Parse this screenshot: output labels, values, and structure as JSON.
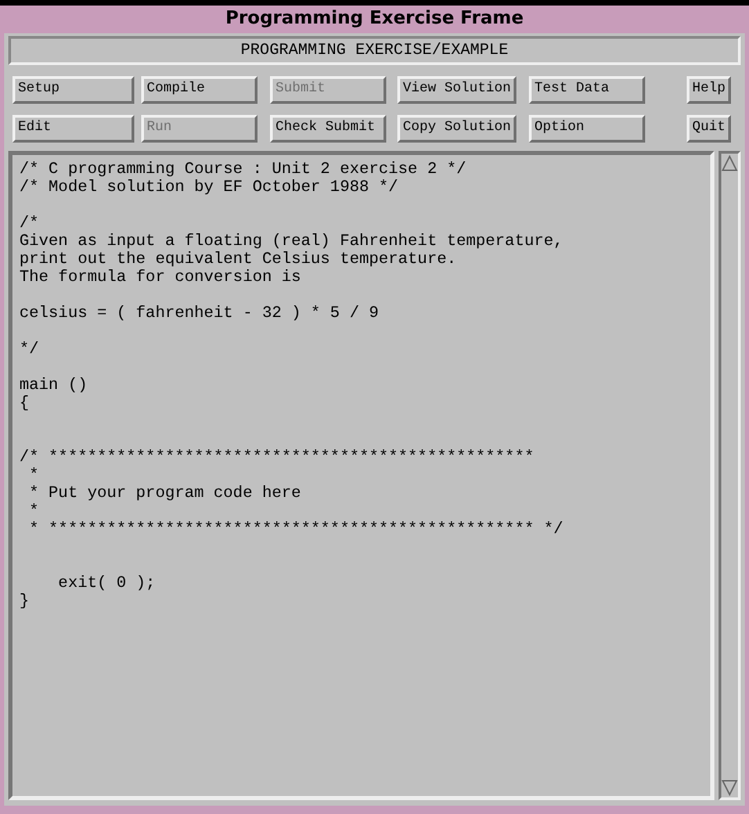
{
  "window": {
    "title": "Programming Exercise Frame"
  },
  "header": "PROGRAMMING EXERCISE/EXAMPLE",
  "button_rows": [
    [
      {
        "label": "Setup",
        "disabled": false
      },
      {
        "label": "Compile",
        "disabled": false
      },
      {
        "label": "Submit",
        "disabled": true
      },
      {
        "label": "View Solution",
        "disabled": false
      },
      {
        "label": "Test Data",
        "disabled": false
      },
      {
        "label": "Help",
        "disabled": false
      }
    ],
    [
      {
        "label": "Edit",
        "disabled": false
      },
      {
        "label": "Run",
        "disabled": true
      },
      {
        "label": "Check Submit",
        "disabled": false
      },
      {
        "label": "Copy Solution",
        "disabled": false
      },
      {
        "label": "Option",
        "disabled": false
      },
      {
        "label": "Quit",
        "disabled": false
      }
    ]
  ],
  "editor": {
    "text": "/* C programming Course : Unit 2 exercise 2 */\n/* Model solution by EF October 1988 */\n\n/*\nGiven as input a floating (real) Fahrenheit temperature,\nprint out the equivalent Celsius temperature.\nThe formula for conversion is\n\ncelsius = ( fahrenheit - 32 ) * 5 / 9\n\n*/\n\nmain ()\n{\n\n\n/* **************************************************\n *\n * Put your program code here\n *\n * ************************************************** */\n\n\n    exit( 0 );\n}"
  }
}
